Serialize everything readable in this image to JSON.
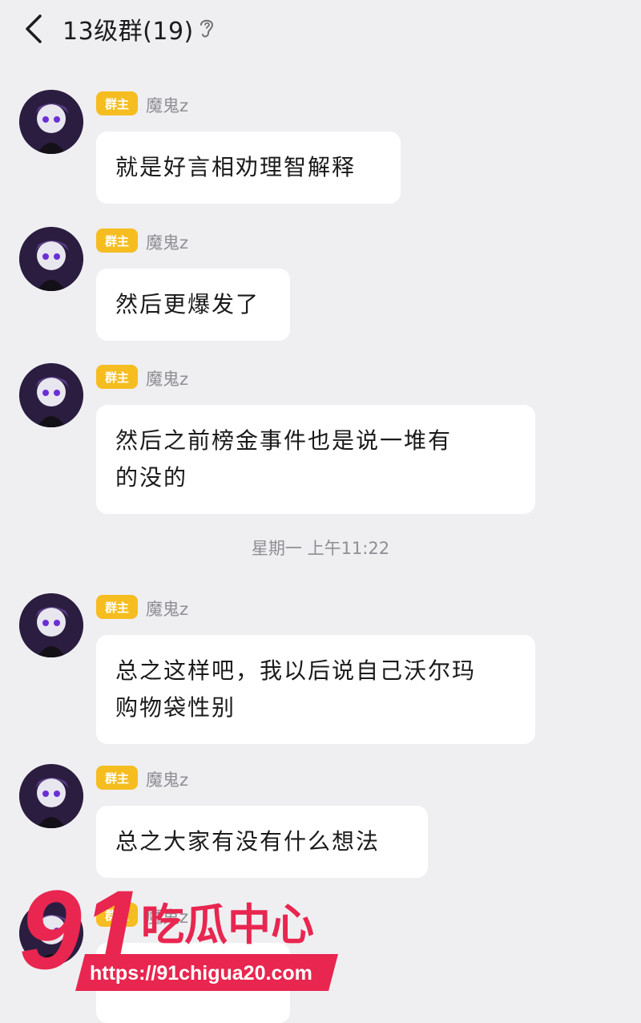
{
  "header": {
    "title": "13级群(19)"
  },
  "role_badge": "群主",
  "messages": [
    {
      "sender": "魔鬼z",
      "lines": [
        "就是好言相劝理智解释"
      ]
    },
    {
      "sender": "魔鬼z",
      "lines": [
        "然后更爆发了"
      ]
    },
    {
      "sender": "魔鬼z",
      "lines": [
        "然后之前榜金事件也是说一堆有",
        "的没的"
      ]
    },
    {
      "sender": "魔鬼z",
      "lines": [
        "总之这样吧，我以后说自己沃尔玛",
        "购物袋性别"
      ]
    },
    {
      "sender": "魔鬼z",
      "lines": [
        "总之大家有没有什么想法"
      ]
    },
    {
      "sender": "魔鬼z",
      "lines": [
        ""
      ]
    }
  ],
  "timestamp": "星期一 上午11:22",
  "watermark": {
    "number": "91",
    "brand": "吃瓜中心",
    "url": "https://91chigua20.com"
  },
  "colors": {
    "background": "#efeff2",
    "badge": "#f5bd1f",
    "watermark": "#e8264f"
  }
}
